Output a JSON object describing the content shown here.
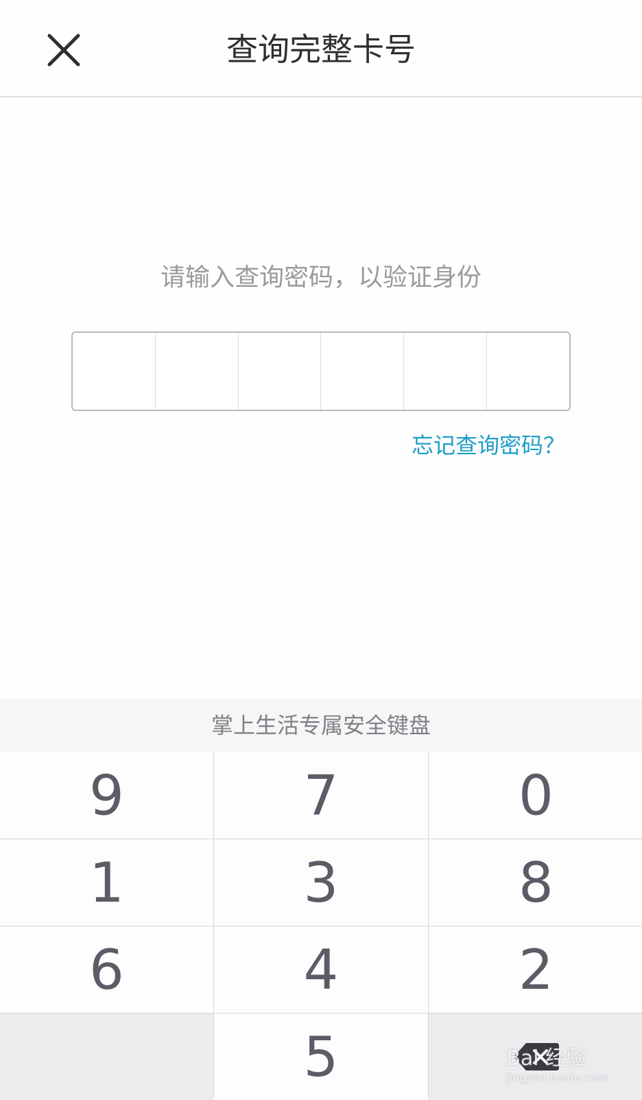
{
  "header": {
    "title": "查询完整卡号",
    "close_icon": "close-icon"
  },
  "main": {
    "prompt": "请输入查询密码，以验证身份",
    "pin_length": 6,
    "forgot_link": "忘记查询密码？"
  },
  "keyboard": {
    "banner": "掌上生活专属安全键盘",
    "keys": [
      "9",
      "7",
      "0",
      "1",
      "3",
      "8",
      "6",
      "4",
      "2",
      "",
      "5",
      "backspace"
    ],
    "backspace_icon": "backspace-icon"
  },
  "watermark": {
    "brand": "Bai 经验",
    "url": "jingyan.baidu.com"
  },
  "colors": {
    "link": "#1c9dc7",
    "key_text": "#5c5c66",
    "title": "#2e2e33"
  }
}
